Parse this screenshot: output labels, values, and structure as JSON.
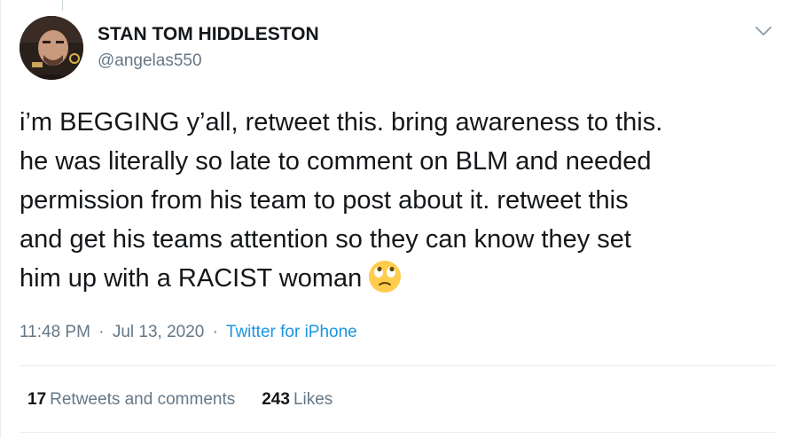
{
  "author": {
    "display_name": "STAN TOM HIDDLESTON",
    "handle": "@angelas550",
    "avatar_icon": "user-avatar"
  },
  "menu": {
    "icon": "chevron-down-icon"
  },
  "tweet": {
    "lines": [
      "i’m BEGGING y’all, retweet this. bring awareness to this.",
      "he was literally so late to comment on BLM and needed",
      "permission from his team to post about it. retweet this",
      "and get his teams attention so they can know they set",
      "him up with a RACIST woman"
    ],
    "emoji": "face-with-rolling-eyes-icon"
  },
  "meta": {
    "time": "11:48 PM",
    "separator": "·",
    "date": "Jul 13, 2020",
    "source": "Twitter for iPhone"
  },
  "stats": {
    "retweets_count": "17",
    "retweets_label": "Retweets and comments",
    "likes_count": "243",
    "likes_label": "Likes"
  },
  "colors": {
    "text": "#14171a",
    "secondary": "#657786",
    "link": "#1b95e0",
    "border": "#e6ecf0"
  }
}
